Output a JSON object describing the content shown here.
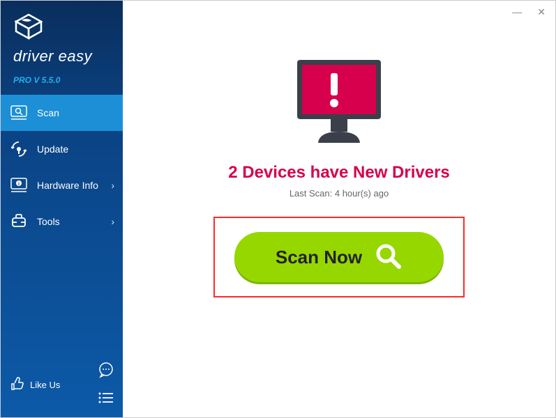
{
  "app": {
    "logo_text": "driver easy",
    "version_text": "PRO V 5.5.0"
  },
  "sidebar": {
    "items": {
      "scan": "Scan",
      "update": "Update",
      "hardware_info": "Hardware Info",
      "tools": "Tools"
    },
    "like_us": "Like Us"
  },
  "main": {
    "headline": "2 Devices have New Drivers",
    "last_scan": "Last Scan: 4 hour(s) ago",
    "scan_button": "Scan Now"
  }
}
